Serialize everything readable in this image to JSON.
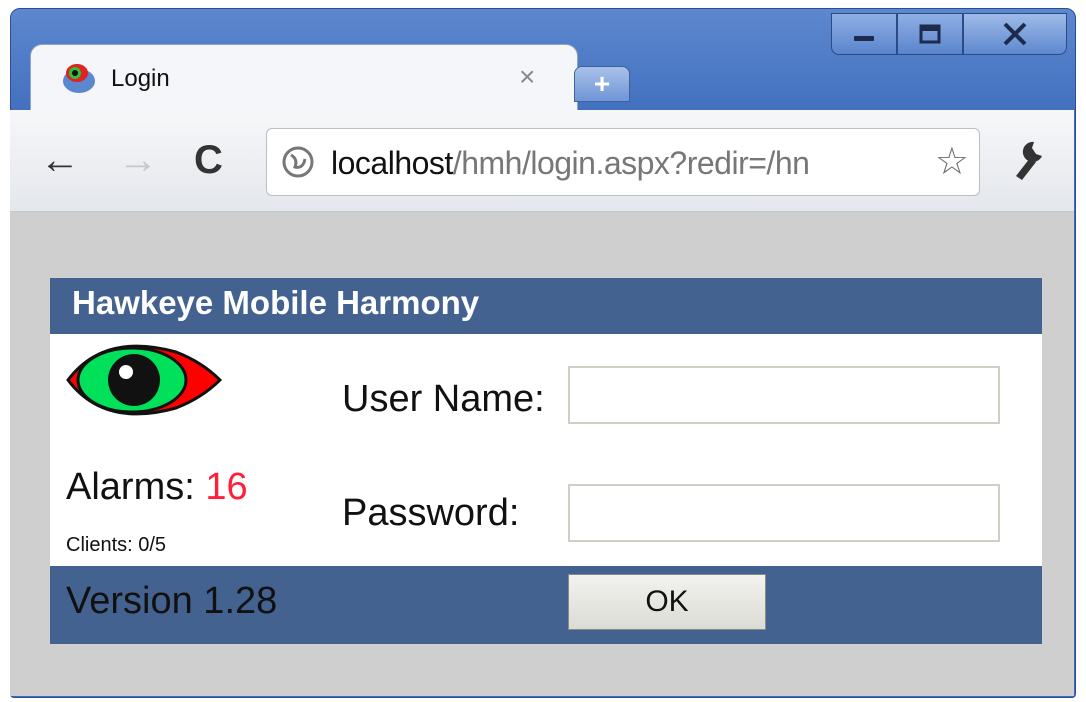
{
  "window": {
    "controls": [
      "minimize-icon",
      "maximize-icon",
      "close-icon"
    ]
  },
  "tab": {
    "title": "Login",
    "close": "×",
    "new_tab": "+"
  },
  "toolbar": {
    "back": "←",
    "forward": "→",
    "reload": "C",
    "url_host": "localhost",
    "url_path": "/hmh/login.aspx?redir=/hn",
    "star": "☆"
  },
  "login": {
    "header": "Hawkeye Mobile Harmony",
    "alarms_label": "Alarms: ",
    "alarms_count": "16",
    "clients": "Clients: 0/5",
    "user_label": "User Name:",
    "password_label": "Password:",
    "user_value": "",
    "password_value": "",
    "version": "Version 1.28",
    "ok_label": "OK"
  },
  "colors": {
    "header_bg": "#44628f",
    "alarm_count": "#ff1f3a",
    "eye_green": "#00e05a",
    "eye_red": "#ff0000"
  }
}
